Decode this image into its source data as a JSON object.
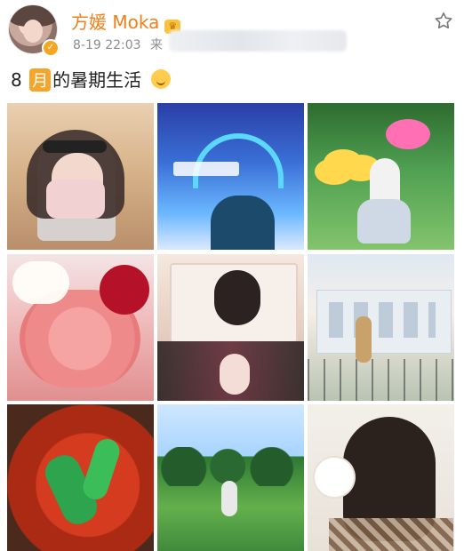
{
  "post": {
    "author": {
      "name": "方媛 Moka",
      "verified_icon": "verified-badge-icon",
      "crown_icon": "vip-crown-icon"
    },
    "meta": {
      "time": "8-19 22:03",
      "source_prefix": "来"
    },
    "content": {
      "month_number": "8",
      "month_badge": "月",
      "text": "的暑期生活",
      "emoji_icon": "smile-emoji-icon"
    },
    "images": [
      {
        "caption": ""
      },
      {
        "caption": ""
      },
      {
        "caption": ""
      },
      {
        "caption": ""
      },
      {
        "caption": ""
      },
      {
        "caption": ""
      },
      {
        "caption": ""
      },
      {
        "caption": ""
      },
      {
        "caption": ""
      }
    ]
  },
  "colors": {
    "username": "#f07f19",
    "meta": "#8c8c8c",
    "month_badge_bg": "#f5a52b",
    "emoji": "#ffcc4d"
  },
  "icons": {
    "star": "star-icon"
  }
}
